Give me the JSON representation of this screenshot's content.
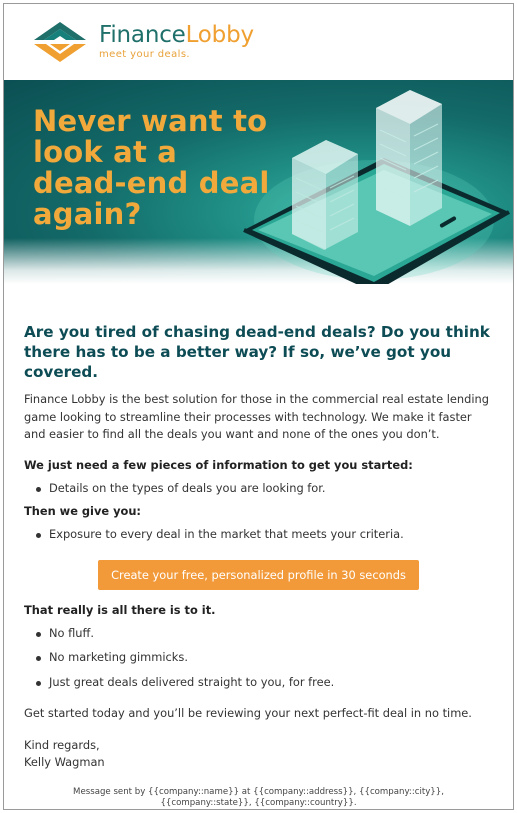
{
  "brand": {
    "name_part1": "Finance",
    "name_part2": "Lobby",
    "tagline": "meet your deals.",
    "colors": {
      "teal": "#1f6f6a",
      "orange": "#f0a030",
      "heading": "#0d4c55",
      "cta": "#f29a3a"
    }
  },
  "hero": {
    "title": "Never want to look at a dead-end deal again?",
    "art": "smartphone-with-buildings-illustration"
  },
  "intro": {
    "heading": "Are you tired of chasing dead-end deals? Do you think there has to be a better way? If so, we’ve got you covered.",
    "paragraph": "Finance Lobby is the best solution for those in the commercial real estate lending game looking to streamline their processes with technology. We make it faster and easier to find all the deals you want and none of the ones you don’t."
  },
  "need": {
    "heading": "We just need a few pieces of information to get you started:",
    "items": [
      "Details on the types of deals you are looking for."
    ]
  },
  "give": {
    "heading": "Then we give you:",
    "items": [
      "Exposure to every deal in the market that meets your criteria."
    ]
  },
  "cta": {
    "label": "Create your free, personalized profile in 30 seconds"
  },
  "closing": {
    "heading": "That really is all there is to it.",
    "items": [
      "No fluff.",
      "No marketing gimmicks.",
      "Just great deals delivered straight to you, for free."
    ],
    "paragraph": "Get started today and you’ll be reviewing your next perfect-fit deal in no time.",
    "signoff": "Kind regards,",
    "signature": "Kelly Wagman"
  },
  "footer": {
    "text": "Message sent by {{company::name}} at {{company::address}}, {{company::city}}, {{company::state}}, {{company::country}}."
  }
}
